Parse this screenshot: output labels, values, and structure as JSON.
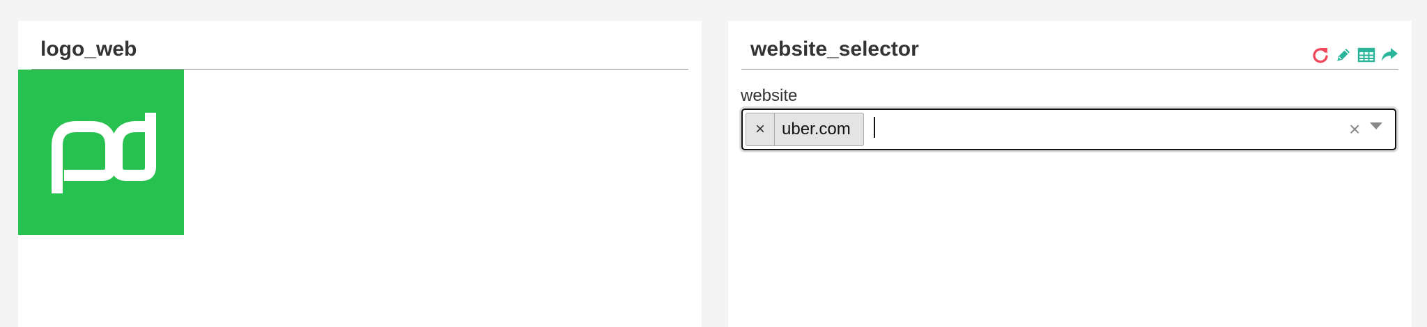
{
  "panels": {
    "left": {
      "title": "logo_web",
      "logo": {
        "text": "pd",
        "background": "#26c14f"
      }
    },
    "right": {
      "title": "website_selector",
      "toolbar": {
        "icons": [
          {
            "name": "refresh-icon",
            "color": "#f0485a"
          },
          {
            "name": "pencil-icon",
            "color": "#2ab59a"
          },
          {
            "name": "table-icon",
            "color": "#2ab59a"
          },
          {
            "name": "share-icon",
            "color": "#2ab59a"
          }
        ]
      },
      "field": {
        "label": "website",
        "selected": [
          "uber.com"
        ],
        "chip_remove": "×",
        "clear_all": "×",
        "input_value": ""
      }
    }
  }
}
